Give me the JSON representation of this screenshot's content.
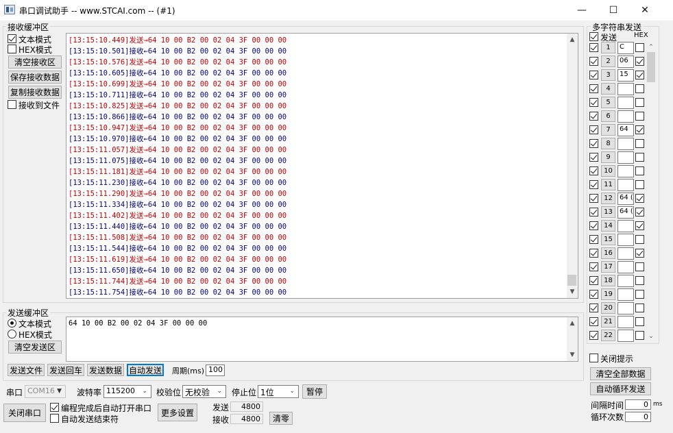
{
  "window": {
    "title": "串口调试助手 -- www.STCAI.com -- (#1)",
    "min_glyph": "—",
    "max_glyph": "☐",
    "close_glyph": "✕"
  },
  "recv": {
    "group_label": "接收缓冲区",
    "text_mode": "文本模式",
    "hex_mode": "HEX模式",
    "clear_btn": "清空接收区",
    "save_btn": "保存接收数据",
    "copy_btn": "复制接收数据",
    "to_file": "接收到文件",
    "colors": {
      "send": "#c00000",
      "recv": "#00007f"
    },
    "lines": [
      {
        "ts": "[13:15:10.449]",
        "dir": "send",
        "tag": "发送→",
        "data": "64 10 00 B2 00 02 04 3F 00 00 00"
      },
      {
        "ts": "[13:15:10.501]",
        "dir": "recv",
        "tag": "接收←",
        "data": "64 10 00 B2 00 02 04 3F 00 00 00"
      },
      {
        "ts": "[13:15:10.576]",
        "dir": "send",
        "tag": "发送→",
        "data": "64 10 00 B2 00 02 04 3F 00 00 00"
      },
      {
        "ts": "[13:15:10.605]",
        "dir": "recv",
        "tag": "接收←",
        "data": "64 10 00 B2 00 02 04 3F 00 00 00"
      },
      {
        "ts": "[13:15:10.699]",
        "dir": "send",
        "tag": "发送→",
        "data": "64 10 00 B2 00 02 04 3F 00 00 00"
      },
      {
        "ts": "[13:15:10.711]",
        "dir": "recv",
        "tag": "接收←",
        "data": "64 10 00 B2 00 02 04 3F 00 00 00"
      },
      {
        "ts": "[13:15:10.825]",
        "dir": "send",
        "tag": "发送→",
        "data": "64 10 00 B2 00 02 04 3F 00 00 00"
      },
      {
        "ts": "[13:15:10.866]",
        "dir": "recv",
        "tag": "接收←",
        "data": "64 10 00 B2 00 02 04 3F 00 00 00"
      },
      {
        "ts": "[13:15:10.947]",
        "dir": "send",
        "tag": "发送→",
        "data": "64 10 00 B2 00 02 04 3F 00 00 00"
      },
      {
        "ts": "[13:15:10.970]",
        "dir": "recv",
        "tag": "接收←",
        "data": "64 10 00 B2 00 02 04 3F 00 00 00"
      },
      {
        "ts": "[13:15:11.057]",
        "dir": "send",
        "tag": "发送→",
        "data": "64 10 00 B2 00 02 04 3F 00 00 00"
      },
      {
        "ts": "[13:15:11.075]",
        "dir": "recv",
        "tag": "接收←",
        "data": "64 10 00 B2 00 02 04 3F 00 00 00"
      },
      {
        "ts": "[13:15:11.181]",
        "dir": "send",
        "tag": "发送→",
        "data": "64 10 00 B2 00 02 04 3F 00 00 00"
      },
      {
        "ts": "[13:15:11.230]",
        "dir": "recv",
        "tag": "接收←",
        "data": "64 10 00 B2 00 02 04 3F 00 00 00"
      },
      {
        "ts": "[13:15:11.290]",
        "dir": "send",
        "tag": "发送→",
        "data": "64 10 00 B2 00 02 04 3F 00 00 00"
      },
      {
        "ts": "[13:15:11.334]",
        "dir": "recv",
        "tag": "接收←",
        "data": "64 10 00 B2 00 02 04 3F 00 00 00"
      },
      {
        "ts": "[13:15:11.402]",
        "dir": "send",
        "tag": "发送→",
        "data": "64 10 00 B2 00 02 04 3F 00 00 00"
      },
      {
        "ts": "[13:15:11.440]",
        "dir": "recv",
        "tag": "接收←",
        "data": "64 10 00 B2 00 02 04 3F 00 00 00"
      },
      {
        "ts": "[13:15:11.508]",
        "dir": "send",
        "tag": "发送→",
        "data": "64 10 00 B2 00 02 04 3F 00 00 00"
      },
      {
        "ts": "[13:15:11.544]",
        "dir": "recv",
        "tag": "接收←",
        "data": "64 10 00 B2 00 02 04 3F 00 00 00"
      },
      {
        "ts": "[13:15:11.619]",
        "dir": "send",
        "tag": "发送→",
        "data": "64 10 00 B2 00 02 04 3F 00 00 00"
      },
      {
        "ts": "[13:15:11.650]",
        "dir": "recv",
        "tag": "接收←",
        "data": "64 10 00 B2 00 02 04 3F 00 00 00"
      },
      {
        "ts": "[13:15:11.744]",
        "dir": "send",
        "tag": "发送→",
        "data": "64 10 00 B2 00 02 04 3F 00 00 00"
      },
      {
        "ts": "[13:15:11.754]",
        "dir": "recv",
        "tag": "接收←",
        "data": "64 10 00 B2 00 02 04 3F 00 00 00"
      }
    ]
  },
  "send": {
    "group_label": "发送缓冲区",
    "text_mode": "文本模式",
    "hex_mode": "HEX模式",
    "clear_btn": "清空发送区",
    "content": "64 10 00 B2 00 02 04 3F 00 00 00",
    "send_file_btn": "发送文件",
    "send_cr_btn": "发送回车",
    "send_data_btn": "发送数据",
    "auto_send_btn": "自动发送",
    "period_label": "周期(ms)",
    "period_value": "100"
  },
  "port": {
    "port_label": "串口",
    "port_value": "COM16",
    "baud_label": "波特率",
    "baud_value": "115200",
    "parity_label": "校验位",
    "parity_value": "无校验",
    "stop_label": "停止位",
    "stop_value": "1位",
    "pause_btn": "暂停",
    "close_port_btn": "关闭串口",
    "auto_open_label": "编程完成后自动打开串口",
    "auto_end_label": "自动发送结束符",
    "more_settings_btn": "更多设置",
    "sent_label": "发送",
    "sent_value": "4800",
    "recv_label": "接收",
    "recv_value": "4800",
    "clear_count_btn": "清零"
  },
  "multi": {
    "group_label": "多字符串发送",
    "send_header": "发送",
    "hex_header": "HEX",
    "rows": [
      {
        "num": "1",
        "text": "C",
        "send": true,
        "hex": false
      },
      {
        "num": "2",
        "text": "06",
        "send": true,
        "hex": true
      },
      {
        "num": "3",
        "text": "15",
        "send": true,
        "hex": true
      },
      {
        "num": "4",
        "text": "",
        "send": true,
        "hex": false
      },
      {
        "num": "5",
        "text": "",
        "send": true,
        "hex": false
      },
      {
        "num": "6",
        "text": "",
        "send": true,
        "hex": false
      },
      {
        "num": "7",
        "text": "64",
        "send": true,
        "hex": true
      },
      {
        "num": "8",
        "text": "",
        "send": true,
        "hex": false
      },
      {
        "num": "9",
        "text": "",
        "send": true,
        "hex": false
      },
      {
        "num": "10",
        "text": "",
        "send": true,
        "hex": false
      },
      {
        "num": "11",
        "text": "",
        "send": true,
        "hex": false
      },
      {
        "num": "12",
        "text": "64 (",
        "send": true,
        "hex": true
      },
      {
        "num": "13",
        "text": "64 (",
        "send": true,
        "hex": true
      },
      {
        "num": "14",
        "text": "",
        "send": true,
        "hex": true
      },
      {
        "num": "15",
        "text": "",
        "send": true,
        "hex": false
      },
      {
        "num": "16",
        "text": "",
        "send": true,
        "hex": true
      },
      {
        "num": "17",
        "text": "",
        "send": true,
        "hex": false
      },
      {
        "num": "18",
        "text": "",
        "send": true,
        "hex": false
      },
      {
        "num": "19",
        "text": "",
        "send": true,
        "hex": false
      },
      {
        "num": "20",
        "text": "",
        "send": true,
        "hex": false
      },
      {
        "num": "21",
        "text": "",
        "send": true,
        "hex": false
      },
      {
        "num": "22",
        "text": "",
        "send": true,
        "hex": false
      }
    ],
    "close_tip_label": "关闭提示",
    "clear_all_btn": "清空全部数据",
    "auto_loop_btn": "自动循环发送",
    "interval_label": "间隔时间",
    "interval_value": "0",
    "interval_unit": "ms",
    "loop_label": "循环次数",
    "loop_value": "0"
  }
}
